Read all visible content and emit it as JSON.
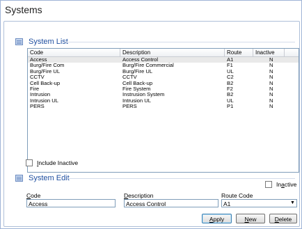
{
  "window": {
    "title": "Systems"
  },
  "system_list": {
    "label": "System List",
    "columns": [
      "Code",
      "Description",
      "Route",
      "Inactive"
    ],
    "rows": [
      {
        "code": "Access",
        "description": "Access Control",
        "route": "A1",
        "inactive": "N"
      },
      {
        "code": "Burg/Fire Com",
        "description": "Burg/Fire Commercial",
        "route": "F1",
        "inactive": "N"
      },
      {
        "code": "Burg/Fire UL",
        "description": "Burg/Fire UL",
        "route": "UL",
        "inactive": "N"
      },
      {
        "code": "CCTV",
        "description": "CCTV",
        "route": "C2",
        "inactive": "N"
      },
      {
        "code": "Cell Back-up",
        "description": "Cell Back-up",
        "route": "B2",
        "inactive": "N"
      },
      {
        "code": "Fire",
        "description": "Fire System",
        "route": "F2",
        "inactive": "N"
      },
      {
        "code": "Intrusion",
        "description": "Instrusion System",
        "route": "B2",
        "inactive": "N"
      },
      {
        "code": "Intrusion UL",
        "description": "Intrusion UL",
        "route": "UL",
        "inactive": "N"
      },
      {
        "code": "PERS",
        "description": "PERS",
        "route": "P1",
        "inactive": "N"
      }
    ],
    "include_inactive_label_underlined": "I",
    "include_inactive_label_rest": "nclude Inactive"
  },
  "system_edit": {
    "label": "System Edit",
    "inactive_label_pre": "In",
    "inactive_label_underlined": "a",
    "inactive_label_post": "ctive",
    "code_label_underlined": "C",
    "code_label_rest": "ode",
    "code_value": "Access",
    "description_label_underlined": "D",
    "description_label_rest": "escription",
    "description_value": "Access Control",
    "route_code_label": "Route Code",
    "route_code_value": "A1"
  },
  "buttons": {
    "apply_underlined": "A",
    "apply_rest": "pply",
    "new_underlined": "N",
    "new_rest": "ew",
    "delete_underlined": "D",
    "delete_rest": "elete"
  }
}
